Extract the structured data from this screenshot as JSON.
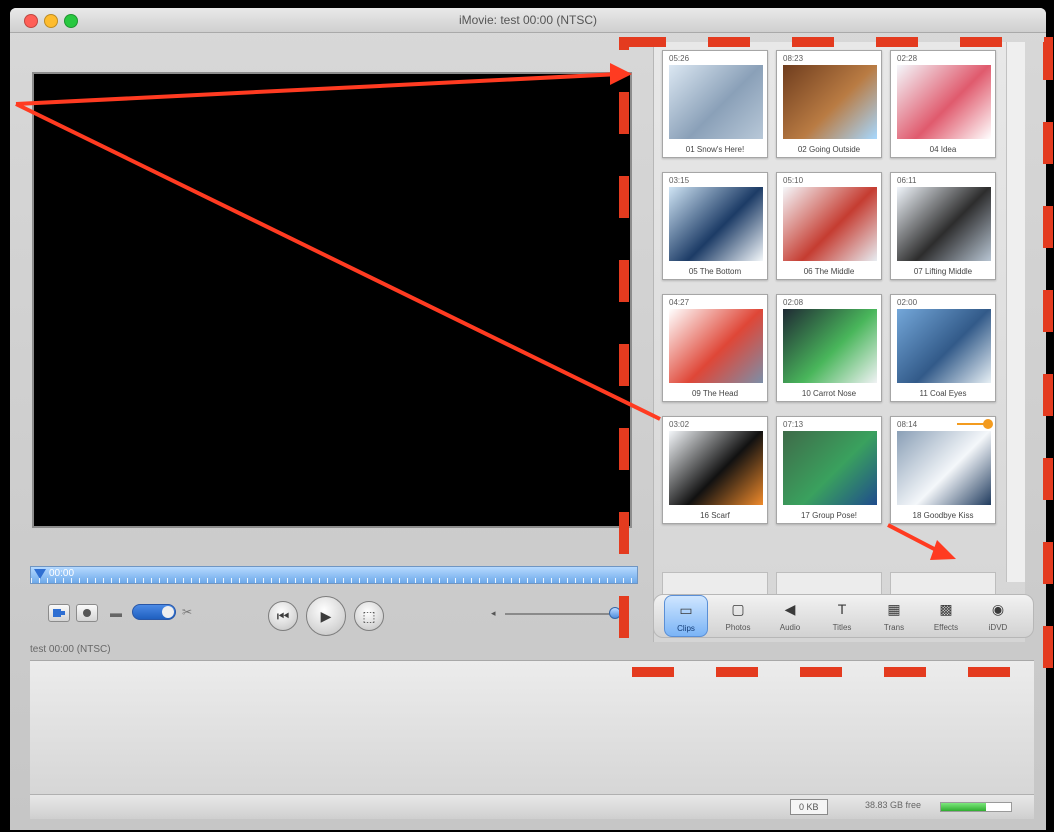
{
  "window": {
    "title": "iMovie: test  00:00 (NTSC)",
    "light_colors": [
      "#ff5f57",
      "#febc2e",
      "#28c840"
    ]
  },
  "scrubber": {
    "time": "00:00"
  },
  "controls": {
    "mode_icons": [
      "camera-mode-icon",
      "edit-mode-icon"
    ],
    "playback": [
      "rewind-icon",
      "play-icon",
      "fullscreen-icon"
    ],
    "volume_knob": "volume-knob",
    "volume_level_percent": 92
  },
  "status": {
    "label": "test  00:00 (NTSC)"
  },
  "clips": [
    {
      "time": "05:26",
      "label": "01 Snow's Here!",
      "colors": [
        "#dbe7f2",
        "#8aa0b8",
        "#b8c8d8"
      ]
    },
    {
      "time": "08:23",
      "label": "02 Going Outside",
      "colors": [
        "#6f3d1e",
        "#b97b43",
        "#a6d8ff"
      ]
    },
    {
      "time": "02:28",
      "label": "04 Idea",
      "colors": [
        "#f4f7fb",
        "#e05a6d",
        "#ffffff"
      ]
    },
    {
      "time": "03:15",
      "label": "05 The Bottom",
      "colors": [
        "#cfe4f4",
        "#1c3b66",
        "#f4f8fb"
      ]
    },
    {
      "time": "05:10",
      "label": "06 The Middle",
      "colors": [
        "#f5f7fa",
        "#c53c31",
        "#e7edf2"
      ]
    },
    {
      "time": "06:11",
      "label": "07 Lifting Middle",
      "colors": [
        "#f0f5fb",
        "#2d2d2d",
        "#b8c5d3"
      ]
    },
    {
      "time": "04:27",
      "label": "09 The Head",
      "colors": [
        "#ffffff",
        "#df4637",
        "#7c8fa8"
      ]
    },
    {
      "time": "02:08",
      "label": "10 Carrot Nose",
      "colors": [
        "#1f2a34",
        "#49b65b",
        "#f0f2f4"
      ]
    },
    {
      "time": "02:00",
      "label": "11 Coal Eyes",
      "colors": [
        "#74a7d9",
        "#325a89",
        "#e7f0f5"
      ]
    },
    {
      "time": "03:02",
      "label": "16 Scarf",
      "colors": [
        "#f4f7fa",
        "#111111",
        "#ef8a2b"
      ]
    },
    {
      "time": "07:13",
      "label": "17 Group Pose!",
      "colors": [
        "#3f6b49",
        "#3aa15e",
        "#1f4c8c"
      ]
    },
    {
      "time": "08:14",
      "label": "18 Goodbye Kiss",
      "colors": [
        "#8a9fb6",
        "#f4f7fa",
        "#203b5e"
      ]
    }
  ],
  "tabs": [
    {
      "label": "Clips",
      "icon": "clips-icon",
      "glyph": "▭",
      "active": true
    },
    {
      "label": "Photos",
      "icon": "photos-icon",
      "glyph": "▢",
      "active": false
    },
    {
      "label": "Audio",
      "icon": "audio-icon",
      "glyph": "◀",
      "active": false
    },
    {
      "label": "Titles",
      "icon": "titles-icon",
      "glyph": "T",
      "active": false
    },
    {
      "label": "Trans",
      "icon": "transitions-icon",
      "glyph": "▦",
      "active": false
    },
    {
      "label": "Effects",
      "icon": "effects-icon",
      "glyph": "▩",
      "active": false
    },
    {
      "label": "iDVD",
      "icon": "idvd-icon",
      "glyph": "◉",
      "active": false
    }
  ],
  "footer": {
    "trash": "0 KB",
    "free": "38.83 GB free",
    "disk_free_percent": 64
  }
}
